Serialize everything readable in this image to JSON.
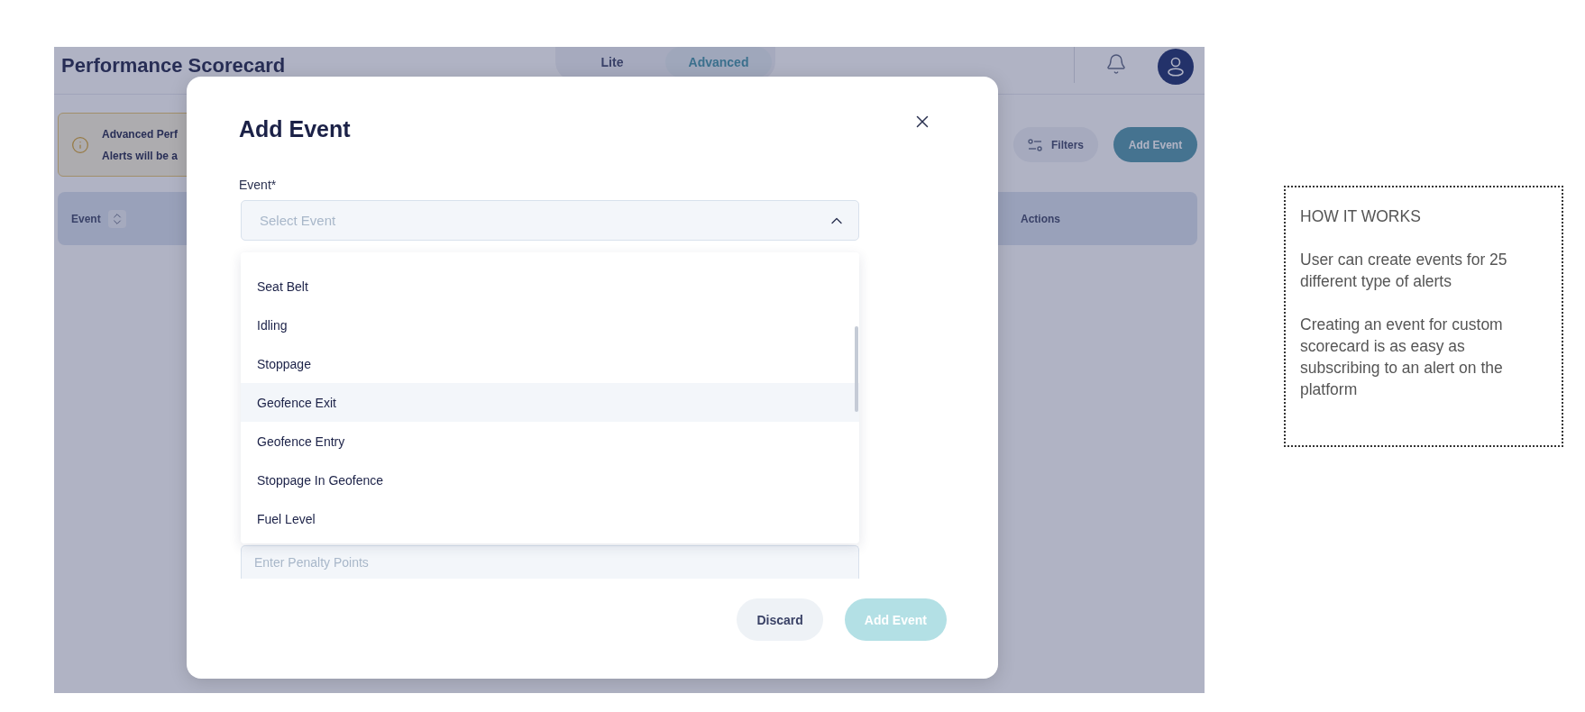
{
  "header": {
    "title": "Performance Scorecard",
    "modes": [
      {
        "label": "Lite",
        "selected": false
      },
      {
        "label": "Advanced",
        "selected": true
      }
    ]
  },
  "banner": {
    "lines": [
      "Advanced Perf",
      "Alerts will be a"
    ]
  },
  "toolbar": {
    "filters": "Filters",
    "add_button": "Add Event"
  },
  "table": {
    "columns": [
      "Event",
      "Actions"
    ]
  },
  "modal": {
    "title": "Add Event",
    "field_label": "Event*",
    "select": {
      "placeholder": "Select Event",
      "expanded": true
    },
    "options": [
      {
        "label": "Seat Belt",
        "selected": false
      },
      {
        "label": "Idling",
        "selected": false
      },
      {
        "label": "Stoppage",
        "selected": false
      },
      {
        "label": "Geofence Exit",
        "selected": true
      },
      {
        "label": "Geofence Entry",
        "selected": false
      },
      {
        "label": "Stoppage In Geofence",
        "selected": false
      },
      {
        "label": "Fuel Level",
        "selected": false
      }
    ],
    "penalty": {
      "placeholder": "Enter Penalty Points"
    },
    "buttons": [
      {
        "label": "Discard",
        "kind": "secondary",
        "disabled": false
      },
      {
        "label": "Add Event",
        "kind": "primary",
        "disabled": true
      }
    ]
  },
  "note": {
    "title": "HOW IT WORKS",
    "paragraphs": [
      "User can create events for 25 different type of alerts",
      "Creating an event for custom scorecard is as easy as subscribing to an alert on the platform"
    ]
  }
}
